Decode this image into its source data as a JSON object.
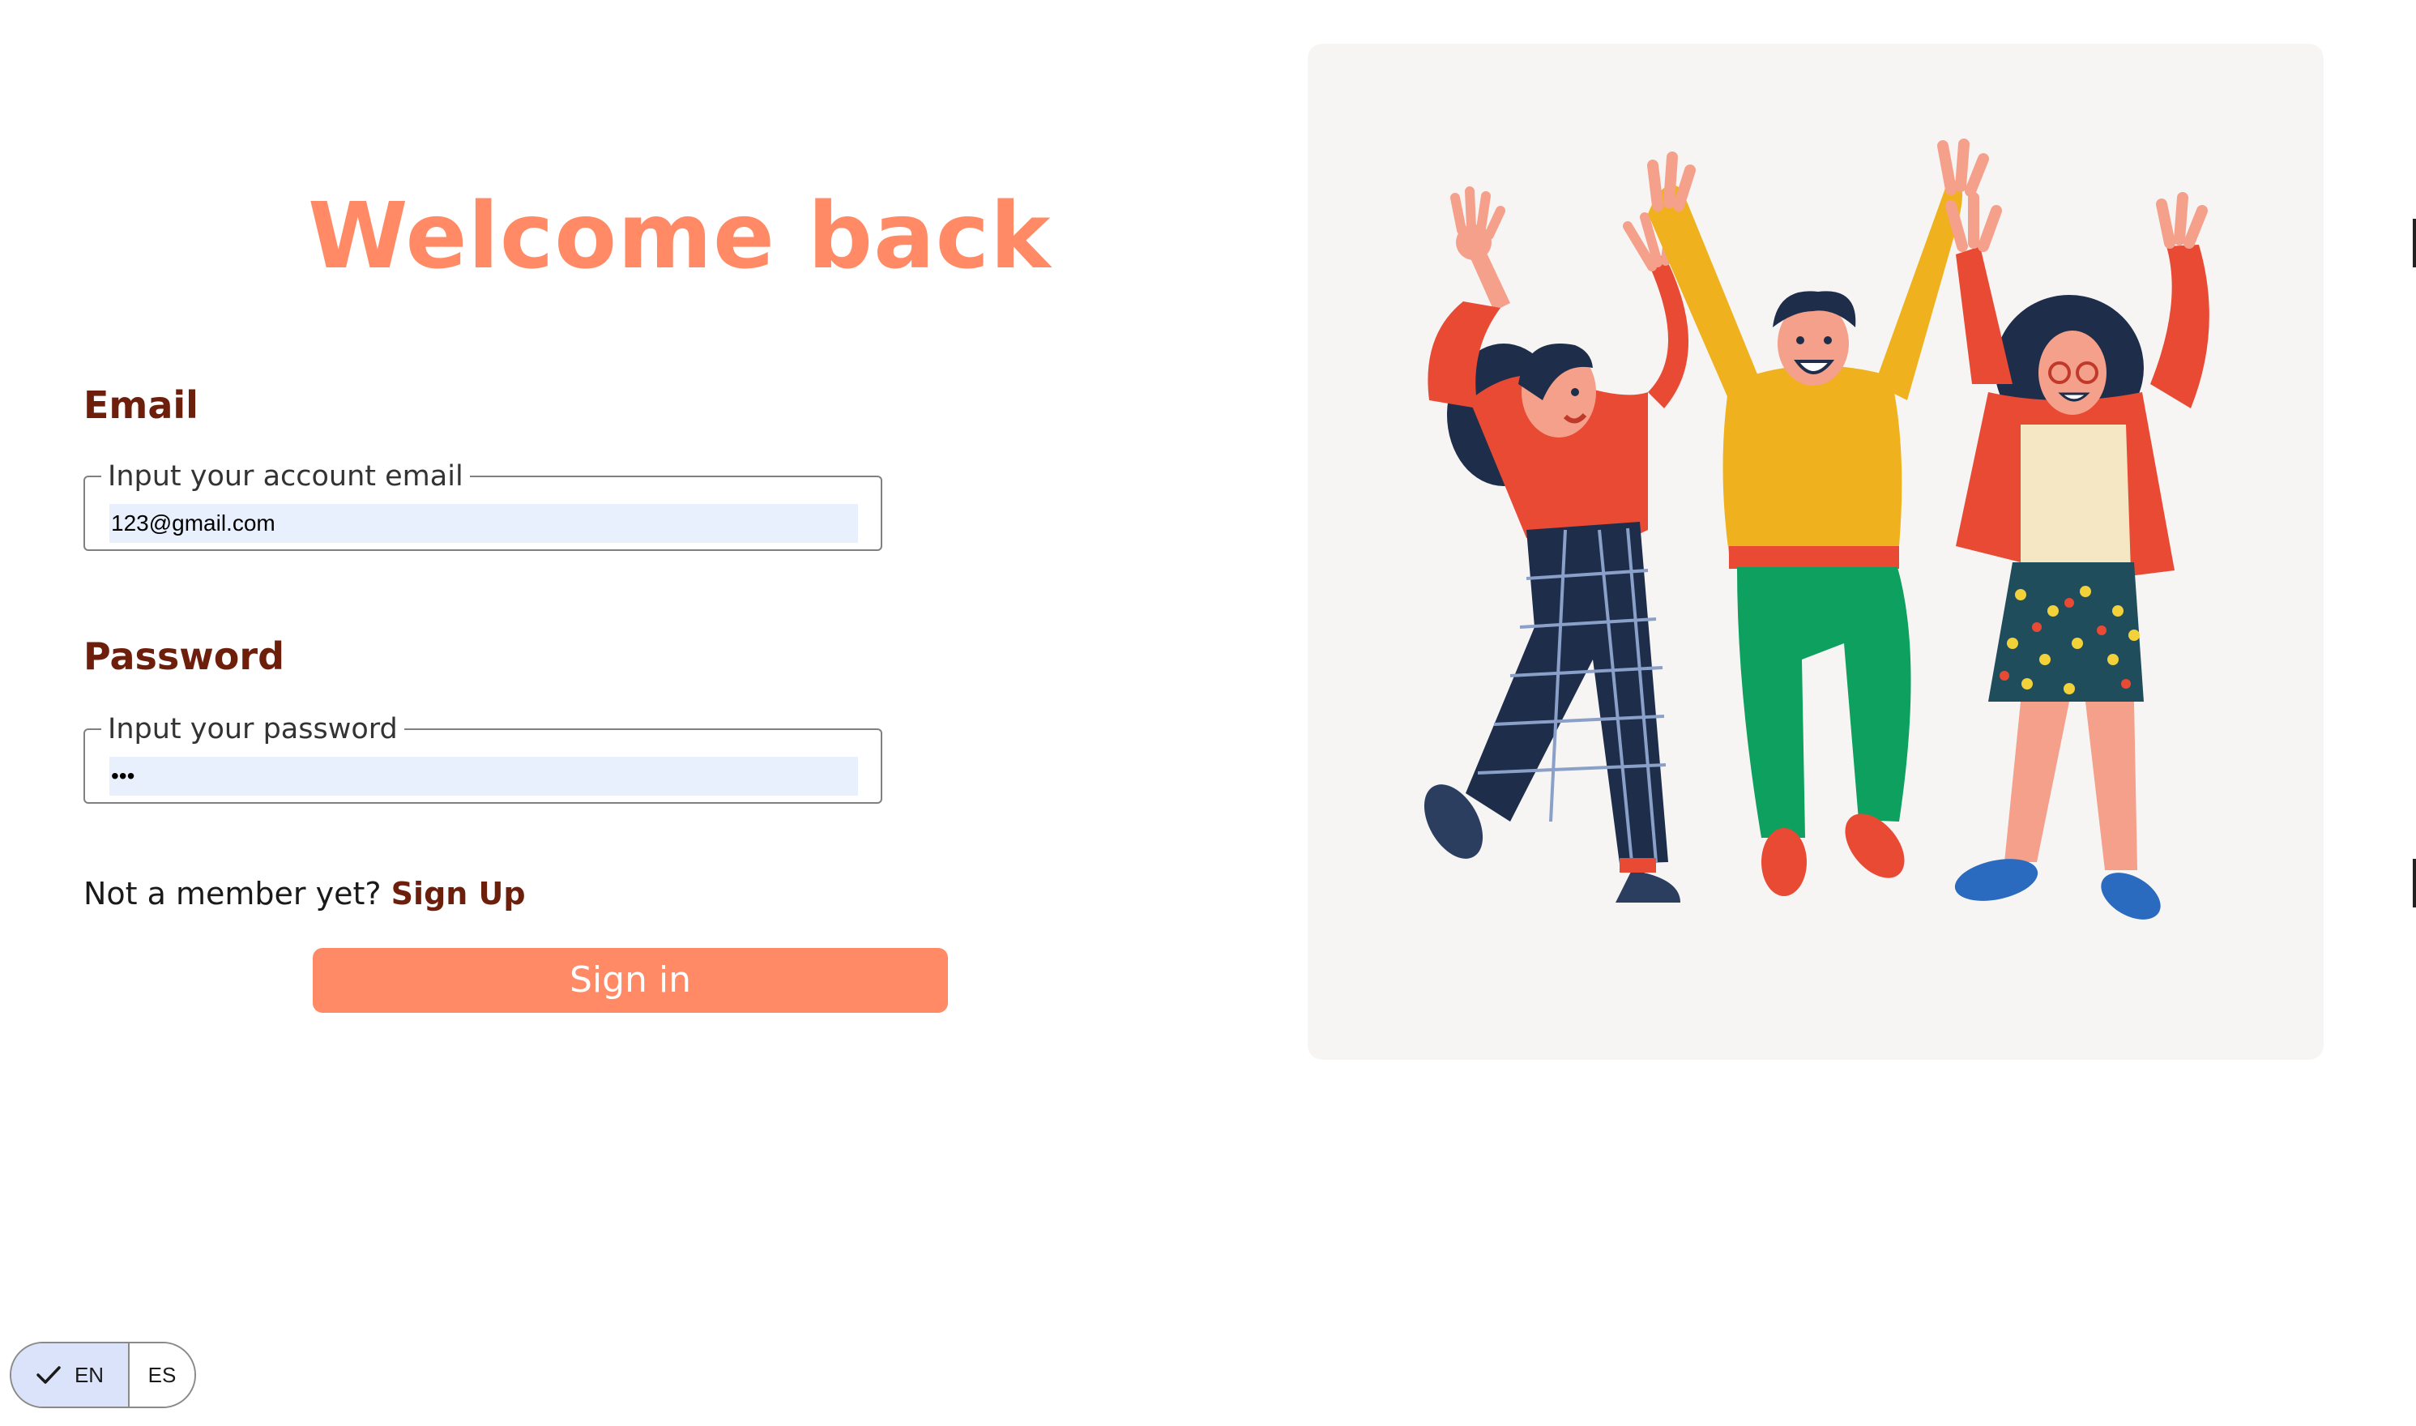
{
  "login": {
    "title": "Welcome back",
    "email": {
      "label": "Email",
      "legend": "Input your account email",
      "value": "123@gmail.com"
    },
    "password": {
      "label": "Password",
      "legend": "Input your password",
      "value": "•••"
    },
    "signup_prompt": "Not a member yet?",
    "signup_link": "Sign Up",
    "submit_label": "Sign in"
  },
  "language": {
    "options": [
      "EN",
      "ES"
    ],
    "selected": "EN"
  },
  "illustration": {
    "subject": "three-people-celebrating",
    "background_color": "#f7f5f4"
  },
  "colors": {
    "accent": "#ff8a65",
    "label": "#6e1f0c",
    "autofill": "#e8f0fe",
    "toggle_selected": "#dbe3fb"
  }
}
